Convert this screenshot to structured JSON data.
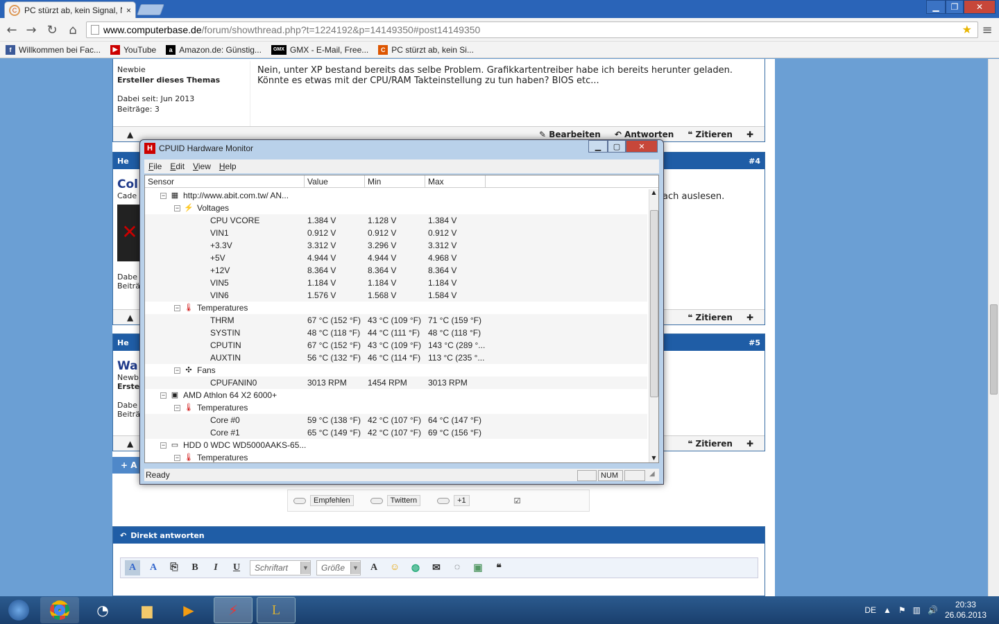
{
  "browser": {
    "tab_title": "PC stürzt ab, kein Signal, N",
    "tab_close": "×",
    "window_controls": {
      "minimize": "▁",
      "restore": "❐",
      "close": "✕"
    },
    "nav": {
      "back": "←",
      "forward": "→",
      "reload": "↻",
      "home": "⌂"
    },
    "url_domain": "www.computerbase.de",
    "url_path": "/forum/showthread.php?t=1224192&p=14149350#post14149350",
    "menu": "≡",
    "bookmarks": [
      {
        "label": "Willkommen bei Fac...",
        "icon": "facebook-icon",
        "color": "#3b5998",
        "glyph": "f"
      },
      {
        "label": "YouTube",
        "icon": "youtube-icon",
        "color": "#cc0000",
        "glyph": "▶"
      },
      {
        "label": "Amazon.de: Günstig...",
        "icon": "amazon-icon",
        "color": "#000000",
        "glyph": "a"
      },
      {
        "label": "GMX - E-Mail, Free...",
        "icon": "gmx-icon",
        "color": "#000000",
        "glyph": "GMX"
      },
      {
        "label": "PC stürzt ab, kein Si...",
        "icon": "computerbase-icon",
        "color": "#dd5500",
        "glyph": "C"
      }
    ]
  },
  "forum": {
    "post3": {
      "rank": "Newbie",
      "creator": "Ersteller dieses Themas",
      "joined": "Dabei seit: Jun 2013",
      "posts": "Beiträge: 3",
      "text": "Nein, unter XP bestand bereits das selbe Problem. Grafikkartentreiber habe ich bereits herunter geladen. Könnte es etwas mit der CPU/RAM Takteinstellung zu tun haben? BIOS etc...",
      "edit": "Bearbeiten",
      "reply": "Antworten",
      "quote": "Zitieren"
    },
    "post4": {
      "number": "#4",
      "head": "He",
      "name": "Col",
      "sub": "Cade",
      "dabei": "Dabe",
      "beitr": "Beiträ",
      "text_tail": "ach auslesen.",
      "quote": "Zitieren"
    },
    "post5": {
      "number": "#5",
      "head": "He",
      "name": "Wa",
      "rank": "Newb",
      "creator": "Erste",
      "dabei": "Dabe",
      "beitr": "Beiträ",
      "quote": "Zitieren"
    },
    "add_btn": "+ A",
    "share": {
      "facebook": "Empfehlen",
      "twitter": "Twittern",
      "gplus": "+1"
    },
    "reply_box": {
      "title": "Direkt antworten",
      "font_placeholder": "Schriftart",
      "size_placeholder": "Größe",
      "bold": "B",
      "italic": "I",
      "underline": "U",
      "color": "A"
    }
  },
  "cpuid": {
    "title": "CPUID Hardware Monitor",
    "menu": [
      "File",
      "Edit",
      "View",
      "Help"
    ],
    "columns": [
      "Sensor",
      "Value",
      "Min",
      "Max"
    ],
    "rows": [
      {
        "level": 0,
        "label": "http://www.abit.com.tw/ AN...",
        "value": "",
        "min": "",
        "max": "",
        "icon": "board-icon",
        "glyph": "▦",
        "exp": "−"
      },
      {
        "level": 1,
        "label": "Voltages",
        "value": "",
        "min": "",
        "max": "",
        "icon": "voltage-icon",
        "glyph": "⚡",
        "exp": "−"
      },
      {
        "level": 2,
        "label": "CPU VCORE",
        "value": "1.384 V",
        "min": "1.128 V",
        "max": "1.384 V"
      },
      {
        "level": 2,
        "label": "VIN1",
        "value": "0.912 V",
        "min": "0.912 V",
        "max": "0.912 V"
      },
      {
        "level": 2,
        "label": "+3.3V",
        "value": "3.312 V",
        "min": "3.296 V",
        "max": "3.312 V"
      },
      {
        "level": 2,
        "label": "+5V",
        "value": "4.944 V",
        "min": "4.944 V",
        "max": "4.968 V"
      },
      {
        "level": 2,
        "label": "+12V",
        "value": "8.364 V",
        "min": "8.364 V",
        "max": "8.364 V"
      },
      {
        "level": 2,
        "label": "VIN5",
        "value": "1.184 V",
        "min": "1.184 V",
        "max": "1.184 V"
      },
      {
        "level": 2,
        "label": "VIN6",
        "value": "1.576 V",
        "min": "1.568 V",
        "max": "1.584 V"
      },
      {
        "level": 1,
        "label": "Temperatures",
        "value": "",
        "min": "",
        "max": "",
        "icon": "thermometer-icon",
        "glyph": "🌡",
        "exp": "−"
      },
      {
        "level": 2,
        "label": "THRM",
        "value": "67 °C  (152 °F)",
        "min": "43 °C  (109 °F)",
        "max": "71 °C  (159 °F)"
      },
      {
        "level": 2,
        "label": "SYSTIN",
        "value": "48 °C  (118 °F)",
        "min": "44 °C  (111 °F)",
        "max": "48 °C  (118 °F)"
      },
      {
        "level": 2,
        "label": "CPUTIN",
        "value": "67 °C  (152 °F)",
        "min": "43 °C  (109 °F)",
        "max": "143 °C  (289 °..."
      },
      {
        "level": 2,
        "label": "AUXTIN",
        "value": "56 °C  (132 °F)",
        "min": "46 °C  (114 °F)",
        "max": "113 °C  (235 °..."
      },
      {
        "level": 1,
        "label": "Fans",
        "value": "",
        "min": "",
        "max": "",
        "icon": "fan-icon",
        "glyph": "✣",
        "exp": "−"
      },
      {
        "level": 2,
        "label": "CPUFANIN0",
        "value": "3013 RPM",
        "min": "1454 RPM",
        "max": "3013 RPM"
      },
      {
        "level": 0,
        "label": "AMD Athlon 64 X2 6000+",
        "value": "",
        "min": "",
        "max": "",
        "icon": "cpu-icon",
        "glyph": "▣",
        "exp": "−"
      },
      {
        "level": 1,
        "label": "Temperatures",
        "value": "",
        "min": "",
        "max": "",
        "icon": "thermometer-icon",
        "glyph": "🌡",
        "exp": "−"
      },
      {
        "level": 2,
        "label": "Core #0",
        "value": "59 °C  (138 °F)",
        "min": "42 °C  (107 °F)",
        "max": "64 °C  (147 °F)"
      },
      {
        "level": 2,
        "label": "Core #1",
        "value": "65 °C  (149 °F)",
        "min": "42 °C  (107 °F)",
        "max": "69 °C  (156 °F)"
      },
      {
        "level": 0,
        "label": "HDD 0 WDC WD5000AAKS-65...",
        "value": "",
        "min": "",
        "max": "",
        "icon": "hdd-icon",
        "glyph": "▭",
        "exp": "−"
      },
      {
        "level": 1,
        "label": "Temperatures",
        "value": "",
        "min": "",
        "max": "",
        "icon": "thermometer-icon",
        "glyph": "🌡",
        "exp": "−"
      }
    ],
    "status": "Ready",
    "num": "NUM"
  },
  "taskbar": {
    "tray_lang": "DE",
    "time": "20:33",
    "date": "26.06.2013"
  },
  "colors": {
    "accent": "#1f5da6",
    "cpuid_frame": "#b9d1ea"
  }
}
